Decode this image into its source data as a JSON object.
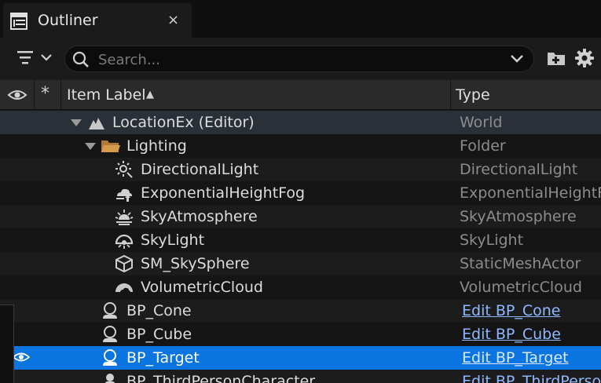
{
  "tab": {
    "title": "Outliner",
    "close_label": "×",
    "icon": "outliner-icon"
  },
  "toolbar": {
    "filter_icon": "filter-icon",
    "search_placeholder": "Search...",
    "search_value": "",
    "add_folder_icon": "add-folder-icon",
    "settings_icon": "gear-icon"
  },
  "columns": {
    "visibility_icon": "eye-icon",
    "pinned": "*",
    "item_label": "Item Label",
    "sort_indicator": "▲",
    "type": "Type"
  },
  "rows": [
    {
      "label": "LocationEx (Editor)",
      "type": "World",
      "icon": "world-icon",
      "expanded": true
    },
    {
      "label": "Lighting",
      "type": "Folder",
      "icon": "folder-icon",
      "expanded": true
    },
    {
      "label": "DirectionalLight",
      "type": "DirectionalLight",
      "icon": "directional-light-icon"
    },
    {
      "label": "ExponentialHeightFog",
      "type": "ExponentialHeightFog",
      "icon": "fog-icon"
    },
    {
      "label": "SkyAtmosphere",
      "type": "SkyAtmosphere",
      "icon": "sky-atmosphere-icon"
    },
    {
      "label": "SkyLight",
      "type": "SkyLight",
      "icon": "skylight-icon"
    },
    {
      "label": "SM_SkySphere",
      "type": "StaticMeshActor",
      "icon": "static-mesh-icon"
    },
    {
      "label": "VolumetricCloud",
      "type": "VolumetricCloud",
      "icon": "cloud-icon"
    },
    {
      "label": "BP_Cone",
      "type": "Edit BP_Cone",
      "icon": "pawn-icon"
    },
    {
      "label": "BP_Cube",
      "type": "Edit BP_Cube",
      "icon": "pawn-icon"
    },
    {
      "label": "BP_Target",
      "type": "Edit BP_Target",
      "icon": "pawn-icon",
      "selected": true
    },
    {
      "label": "BP_ThirdPersonCharacter",
      "type": "Edit BP_ThirdPersonCharacter",
      "icon": "character-icon"
    }
  ],
  "colors": {
    "selection": "#0a74e0",
    "link": "#8fb8ff",
    "background": "#151515"
  }
}
